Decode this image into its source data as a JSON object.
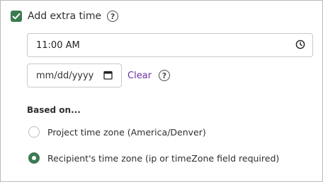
{
  "extra_time": {
    "checkbox_label": "Add extra time",
    "checked": true,
    "help_glyph": "?"
  },
  "time_field": {
    "value": "11:00 AM",
    "icon": "clock-icon"
  },
  "date_field": {
    "placeholder": "mm/dd/yyyy",
    "icon": "calendar-icon",
    "clear_label": "Clear",
    "help_glyph": "?"
  },
  "based_on": {
    "heading": "Based on...",
    "options": [
      {
        "label": "Project time zone (America/Denver)",
        "selected": false
      },
      {
        "label": "Recipient's time zone (ip or timeZone field required)",
        "selected": true
      }
    ]
  },
  "colors": {
    "accent_green": "#3c7a52",
    "link_purple": "#6b2fa6",
    "border_gray": "#c9c9c9"
  }
}
